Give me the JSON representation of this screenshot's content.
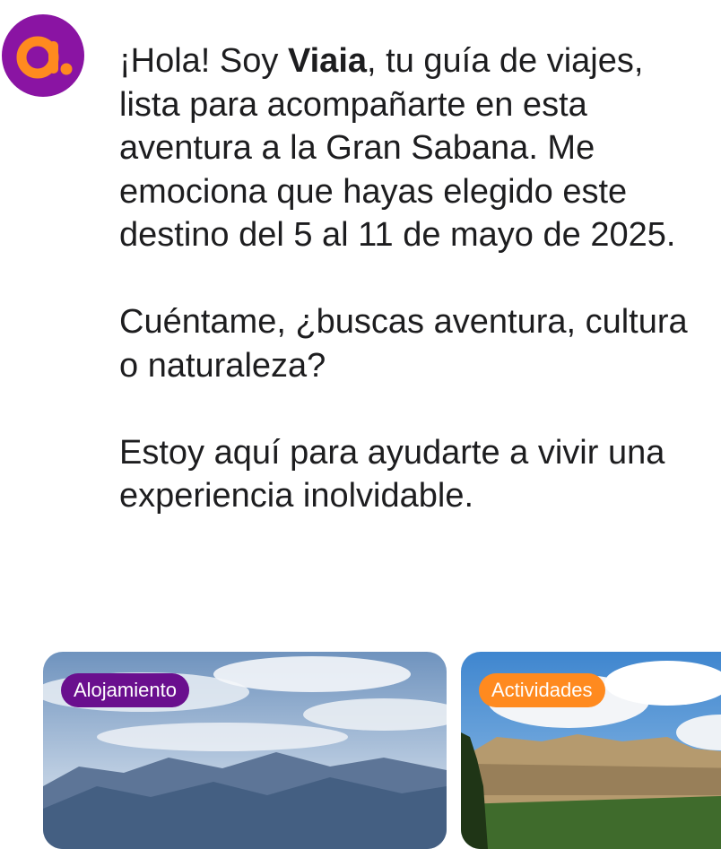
{
  "assistant": {
    "name": "Viaia",
    "avatar_icon": "viaia-logo-icon",
    "avatar_color": "#8a14a3",
    "logo_accent": "#ff8a1f"
  },
  "message": {
    "greeting_before": "¡Hola! Soy ",
    "greeting_name": "Viaia",
    "greeting_after": ", tu guía de viajes, lista para acompañarte en esta aventura a la Gran Sabana. Me emociona que hayas elegido este destino del 5 al 11 de mayo de 2025.",
    "question": "Cuéntame, ¿buscas aventura, cultura o naturaleza?",
    "closing": "Estoy aquí para ayudarte a vivir una experiencia inolvidable."
  },
  "cards": [
    {
      "badge": "Alojamiento",
      "badge_color": "#6a0f8e",
      "image": "mountain-landscape"
    },
    {
      "badge": "Actividades",
      "badge_color": "#ff8a1f",
      "image": "tepui-landscape"
    }
  ]
}
